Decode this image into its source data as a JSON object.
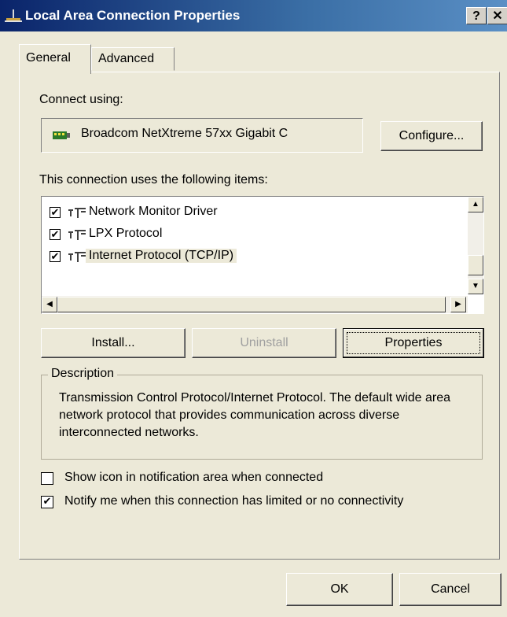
{
  "window": {
    "title": "Local Area Connection Properties",
    "help_label": "?",
    "close_label": "✕"
  },
  "tabs": [
    {
      "label": "General",
      "active": true
    },
    {
      "label": "Advanced",
      "active": false
    }
  ],
  "general": {
    "connect_using_label": "Connect using:",
    "adapter_name": "Broadcom NetXtreme 57xx Gigabit C",
    "configure_label": "Configure...",
    "items_label": "This connection uses the following items:",
    "items": [
      {
        "label": "Network Monitor Driver",
        "checked": true
      },
      {
        "label": "LPX Protocol",
        "checked": true
      },
      {
        "label": "Internet Protocol (TCP/IP)",
        "checked": true,
        "selected": true
      }
    ],
    "install_label": "Install...",
    "uninstall_label": "Uninstall",
    "properties_label": "Properties",
    "description_title": "Description",
    "description_text": "Transmission Control Protocol/Internet Protocol. The default wide area network protocol that provides communication across diverse interconnected networks.",
    "show_icon_label": "Show icon in notification area when connected",
    "show_icon_checked": false,
    "notify_label": "Notify me when this connection has limited or no connectivity",
    "notify_checked": true
  },
  "footer": {
    "ok_label": "OK",
    "cancel_label": "Cancel"
  },
  "colors": {
    "dialog_bg": "#ece9d8",
    "titlebar": "#0a246a"
  }
}
